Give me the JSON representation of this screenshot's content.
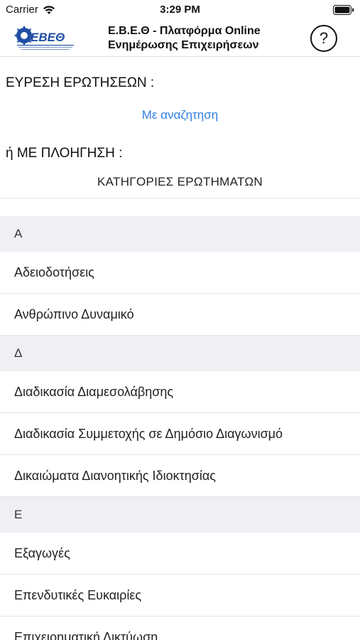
{
  "status_bar": {
    "carrier": "Carrier",
    "time": "3:29 PM"
  },
  "nav": {
    "logo_text": "ΕΒΕΘ",
    "title_line1": "Ε.Β.Ε.Θ - Πλατφόρμα Online",
    "title_line2": "Ενημέρωσης Επιχειρήσεων",
    "help_label": "?"
  },
  "content": {
    "find_questions_label": "ΕΥΡΕΣΗ ΕΡΩΤΗΣΕΩΝ :",
    "search_link": "Με αναζητηση",
    "browse_label": "ή ΜΕ ΠΛΟΗΓΗΣΗ :",
    "categories_title": "ΚΑΤΗΓΟΡΙΕΣ ΕΡΩΤΗΜΑΤΩΝ"
  },
  "list": [
    {
      "type": "section",
      "label": "Α"
    },
    {
      "type": "item",
      "label": "Αδειοδοτήσεις"
    },
    {
      "type": "item",
      "label": "Ανθρώπινο Δυναμικό"
    },
    {
      "type": "section",
      "label": "Δ"
    },
    {
      "type": "item",
      "label": "Διαδικασία Διαμεσολάβησης"
    },
    {
      "type": "item",
      "label": "Διαδικασία Συμμετοχής σε Δημόσιο Διαγωνισμό"
    },
    {
      "type": "item",
      "label": "Δικαιώματα Διανοητικής Ιδιοκτησίας"
    },
    {
      "type": "section",
      "label": "Ε"
    },
    {
      "type": "item",
      "label": "Εξαγωγές"
    },
    {
      "type": "item",
      "label": "Επενδυτικές Ευκαιρίες"
    },
    {
      "type": "item",
      "label": "Επιχειρηματική Δικτύωση"
    }
  ],
  "colors": {
    "link": "#2f7fe0",
    "logo_blue": "#1f4fa3",
    "section_bg": "#efeff4"
  }
}
